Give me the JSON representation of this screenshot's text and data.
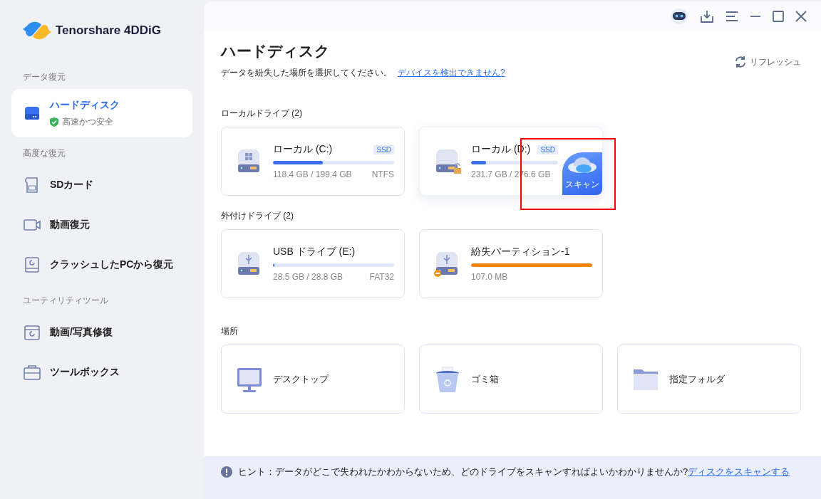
{
  "app": {
    "name": "Tenorshare 4DDiG"
  },
  "sidebar": {
    "sections": [
      {
        "title": "データ復元",
        "items": [
          {
            "label": "ハードディスク",
            "sublabel": "高速かつ安全",
            "kind": "disk",
            "selected": true
          }
        ]
      },
      {
        "title": "高度な復元",
        "items": [
          {
            "label": "SDカード",
            "kind": "sd",
            "selected": false
          },
          {
            "label": "動画復元",
            "kind": "video",
            "selected": false
          },
          {
            "label": "クラッシュしたPCから復元",
            "kind": "pc",
            "selected": false
          }
        ]
      },
      {
        "title": "ユーティリティツール",
        "items": [
          {
            "label": "動画/写真修復",
            "kind": "repair",
            "selected": false
          },
          {
            "label": "ツールボックス",
            "kind": "toolbox",
            "selected": false
          }
        ]
      }
    ]
  },
  "header": {
    "title": "ハードディスク",
    "subtitle": "データを紛失した場所を選択してください。",
    "link": "デバイスを検出できません?",
    "refresh": "リフレッシュ"
  },
  "drive_groups": [
    {
      "title": "ローカルドライブ (2)",
      "drives": [
        {
          "name": "ローカル (C:)",
          "kind": "windows",
          "badge": "SSD",
          "level": 0.41,
          "color": "#3a6ff0",
          "size": "118.4 GB / 199.4 GB",
          "fs": "NTFS",
          "hovered": false
        },
        {
          "name": "ローカル (D:)",
          "kind": "locked",
          "badge": "SSD",
          "level": 0.17,
          "color": "#3a6ff0",
          "size": "231.7 GB / 276.6 GB",
          "hovered": true,
          "scan": "スキャン",
          "annotated": true
        }
      ]
    },
    {
      "title": "外付けドライブ (2)",
      "drives": [
        {
          "name": "USB ドライブ (E:)",
          "kind": "usb",
          "level": 0.01,
          "color": "#3a6ff0",
          "size": "28.5 GB / 28.8 GB",
          "fs": "FAT32",
          "hovered": false
        },
        {
          "name": "紛失パーティション-1",
          "kind": "lost",
          "level": 1,
          "color": "#f5840c",
          "size": "107.0 MB",
          "hovered": false
        }
      ]
    }
  ],
  "places": {
    "title": "場所",
    "items": [
      {
        "label": "デスクトップ",
        "kind": "monitor"
      },
      {
        "label": "ゴミ箱",
        "kind": "trash"
      },
      {
        "label": "指定フォルダ",
        "kind": "folder"
      }
    ]
  },
  "hint": {
    "text": "ヒント：データがどこで失われたかわからないため、どのドライブをスキャンすればよいかわかりませんか?",
    "link": "ディスクをスキャンする"
  }
}
